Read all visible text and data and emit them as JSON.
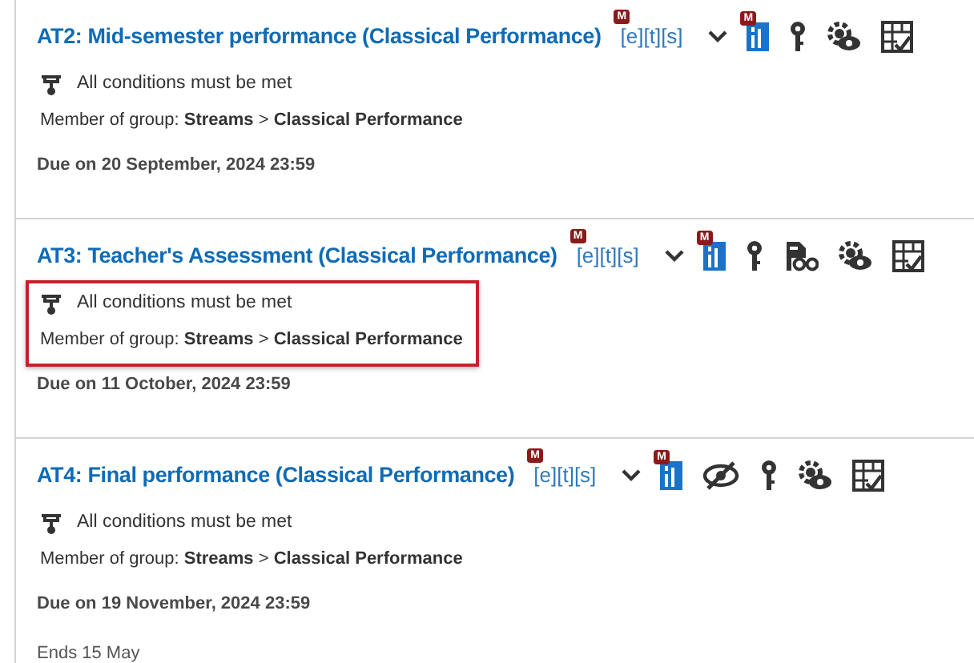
{
  "items": [
    {
      "title": "AT2: Mid-semester performance (Classical Performance)",
      "tag": "[e][t][s]",
      "tag_badge": "M",
      "icons": [
        {
          "kind": "stats",
          "badge": "M"
        },
        {
          "kind": "key"
        },
        {
          "kind": "settings-eye"
        },
        {
          "kind": "rubric"
        }
      ],
      "conditions": "All conditions must be met",
      "group": "Member of group: **Streams** > **Classical Performance**",
      "due": "Due on 20 September, 2024 23:59",
      "highlighted": false
    },
    {
      "title": "AT3: Teacher's Assessment (Classical Performance)",
      "tag": "[e][t][s]",
      "tag_badge": "M",
      "icons": [
        {
          "kind": "stats",
          "badge": "M"
        },
        {
          "kind": "key"
        },
        {
          "kind": "doc-glasses"
        },
        {
          "kind": "settings-eye"
        },
        {
          "kind": "rubric"
        }
      ],
      "conditions": "All conditions must be met",
      "group": "Member of group: **Streams** > **Classical Performance**",
      "due": "Due on 11 October, 2024 23:59",
      "highlighted": true
    },
    {
      "title": "AT4: Final performance (Classical Performance)",
      "tag": "[e][t][s]",
      "tag_badge": "M",
      "icons": [
        {
          "kind": "stats",
          "badge": "M"
        },
        {
          "kind": "hidden-eye"
        },
        {
          "kind": "key"
        },
        {
          "kind": "settings-eye"
        },
        {
          "kind": "rubric"
        }
      ],
      "conditions": "All conditions must be met",
      "group": "Member of group: **Streams** > **Classical Performance**",
      "due": "Due on 19 November, 2024 23:59",
      "ends": "Ends 15 May",
      "highlighted": false
    }
  ]
}
